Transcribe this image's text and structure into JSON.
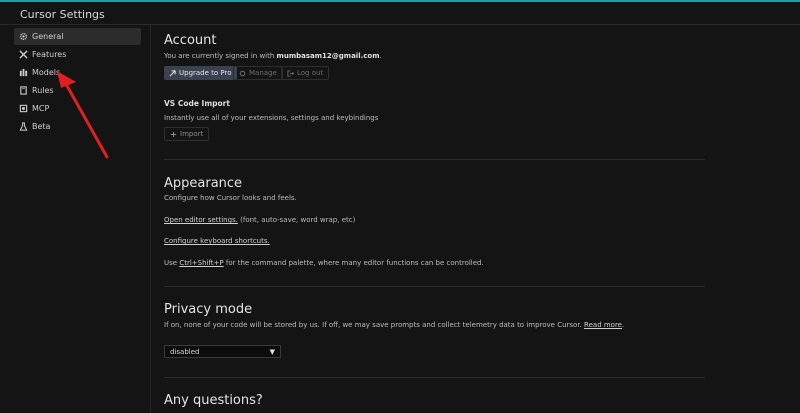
{
  "window": {
    "title": "Cursor Settings"
  },
  "sidebar": {
    "items": [
      {
        "label": "General",
        "icon": "gear-icon",
        "active": true
      },
      {
        "label": "Features",
        "icon": "tools-icon"
      },
      {
        "label": "Models",
        "icon": "models-icon"
      },
      {
        "label": "Rules",
        "icon": "book-icon"
      },
      {
        "label": "MCP",
        "icon": "mcp-icon"
      },
      {
        "label": "Beta",
        "icon": "flask-icon"
      }
    ]
  },
  "account": {
    "title": "Account",
    "signed_in_prefix": "You are currently signed in with",
    "email": "mumbasam12@gmail.com",
    "signed_in_suffix": ".",
    "upgrade_label": "Upgrade to Pro",
    "manage_label": "Manage",
    "logout_label": "Log out"
  },
  "vscode_import": {
    "title": "VS Code Import",
    "description": "Instantly use all of your extensions, settings and keybindings",
    "import_label": "Import"
  },
  "appearance": {
    "title": "Appearance",
    "description": "Configure how Cursor looks and feels.",
    "editor_settings_link": "Open editor settings.",
    "editor_settings_suffix": "(font, auto-save, word wrap, etc)",
    "keyboard_shortcuts_link": "Configure keyboard shortcuts.",
    "palette_prefix": "Use",
    "palette_shortcut": "Ctrl+Shift+P",
    "palette_suffix": "for the command palette, where many editor functions can be controlled."
  },
  "privacy": {
    "title": "Privacy mode",
    "description": "If on, none of your code will be stored by us. If off, we may save prompts and collect telemetry data to improve Cursor.",
    "read_more": "Read more",
    "read_more_suffix": ".",
    "selected": "disabled"
  },
  "questions": {
    "title": "Any questions?"
  },
  "colors": {
    "accent_top": "#1e9fa6",
    "annotation_arrow": "#e02020",
    "primary_button": "#3a4150"
  }
}
